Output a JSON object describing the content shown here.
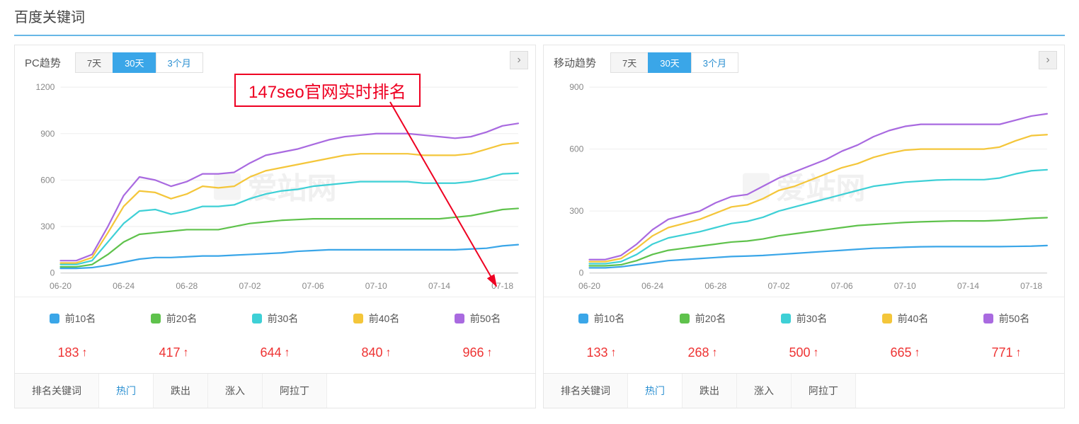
{
  "title": "百度关键词",
  "annotation": "147seo官网实时排名",
  "watermark": "爱站网",
  "range_buttons": [
    "7天",
    "30天",
    "3个月"
  ],
  "panels": [
    {
      "key": "pc",
      "title": "PC趋势",
      "active_range": "30天",
      "stats": [
        183,
        417,
        644,
        840,
        966
      ],
      "tabs": [
        "排名关键词",
        "热门",
        "跌出",
        "涨入",
        "阿拉丁"
      ],
      "active_tab": "热门"
    },
    {
      "key": "mobile",
      "title": "移动趋势",
      "active_range": "30天",
      "stats": [
        133,
        268,
        500,
        665,
        771
      ],
      "tabs": [
        "排名关键词",
        "热门",
        "跌出",
        "涨入",
        "阿拉丁"
      ],
      "active_tab": "热门"
    }
  ],
  "legend": [
    {
      "label": "前10名",
      "color": "#3aa6e8"
    },
    {
      "label": "前20名",
      "color": "#5fc24c"
    },
    {
      "label": "前30名",
      "color": "#3ed0d6"
    },
    {
      "label": "前40名",
      "color": "#f4c63a"
    },
    {
      "label": "前50名",
      "color": "#a96ae0"
    }
  ],
  "chart_data": [
    {
      "panel": "pc",
      "type": "line",
      "xlabel": "",
      "ylabel": "",
      "title": "",
      "x_ticks": [
        "06-20",
        "06-24",
        "06-28",
        "07-02",
        "07-06",
        "07-10",
        "07-14",
        "07-18"
      ],
      "y_ticks": [
        0,
        300,
        600,
        900,
        1200
      ],
      "ylim": [
        0,
        1200
      ],
      "categories": [
        "06-20",
        "06-21",
        "06-22",
        "06-23",
        "06-24",
        "06-25",
        "06-26",
        "06-27",
        "06-28",
        "06-29",
        "06-30",
        "07-01",
        "07-02",
        "07-03",
        "07-04",
        "07-05",
        "07-06",
        "07-07",
        "07-08",
        "07-09",
        "07-10",
        "07-11",
        "07-12",
        "07-13",
        "07-14",
        "07-15",
        "07-16",
        "07-17",
        "07-18",
        "07-19"
      ],
      "series": [
        {
          "name": "前10名",
          "color": "#3aa6e8",
          "values": [
            30,
            30,
            35,
            50,
            70,
            90,
            100,
            100,
            105,
            110,
            110,
            115,
            120,
            125,
            130,
            140,
            145,
            150,
            150,
            150,
            150,
            150,
            150,
            150,
            150,
            150,
            155,
            160,
            175,
            183
          ]
        },
        {
          "name": "前20名",
          "color": "#5fc24c",
          "values": [
            40,
            40,
            55,
            120,
            200,
            250,
            260,
            270,
            280,
            280,
            280,
            300,
            320,
            330,
            340,
            345,
            350,
            350,
            350,
            350,
            350,
            350,
            350,
            350,
            350,
            360,
            370,
            390,
            410,
            417
          ]
        },
        {
          "name": "前30名",
          "color": "#3ed0d6",
          "values": [
            55,
            55,
            80,
            200,
            320,
            400,
            410,
            380,
            400,
            430,
            430,
            440,
            480,
            510,
            530,
            540,
            560,
            570,
            580,
            590,
            590,
            590,
            590,
            580,
            580,
            580,
            590,
            610,
            640,
            644
          ]
        },
        {
          "name": "前40名",
          "color": "#f4c63a",
          "values": [
            65,
            65,
            100,
            260,
            430,
            530,
            520,
            480,
            510,
            560,
            550,
            560,
            620,
            660,
            680,
            700,
            720,
            740,
            760,
            770,
            770,
            770,
            770,
            760,
            760,
            760,
            770,
            800,
            830,
            840
          ]
        },
        {
          "name": "前50名",
          "color": "#a96ae0",
          "values": [
            80,
            80,
            120,
            300,
            500,
            620,
            600,
            560,
            590,
            640,
            640,
            650,
            710,
            760,
            780,
            800,
            830,
            860,
            880,
            890,
            900,
            900,
            900,
            890,
            880,
            870,
            880,
            910,
            950,
            966
          ]
        }
      ]
    },
    {
      "panel": "mobile",
      "type": "line",
      "xlabel": "",
      "ylabel": "",
      "title": "",
      "x_ticks": [
        "06-20",
        "06-24",
        "06-28",
        "07-02",
        "07-06",
        "07-10",
        "07-14",
        "07-18"
      ],
      "y_ticks": [
        0,
        300,
        600,
        900
      ],
      "ylim": [
        0,
        900
      ],
      "categories": [
        "06-20",
        "06-21",
        "06-22",
        "06-23",
        "06-24",
        "06-25",
        "06-26",
        "06-27",
        "06-28",
        "06-29",
        "06-30",
        "07-01",
        "07-02",
        "07-03",
        "07-04",
        "07-05",
        "07-06",
        "07-07",
        "07-08",
        "07-09",
        "07-10",
        "07-11",
        "07-12",
        "07-13",
        "07-14",
        "07-15",
        "07-16",
        "07-17",
        "07-18",
        "07-19"
      ],
      "series": [
        {
          "name": "前10名",
          "color": "#3aa6e8",
          "values": [
            25,
            25,
            30,
            40,
            50,
            60,
            65,
            70,
            75,
            80,
            82,
            85,
            90,
            95,
            100,
            105,
            110,
            115,
            120,
            122,
            125,
            127,
            128,
            128,
            128,
            128,
            128,
            129,
            130,
            133
          ]
        },
        {
          "name": "前20名",
          "color": "#5fc24c",
          "values": [
            35,
            35,
            40,
            60,
            90,
            110,
            120,
            130,
            140,
            150,
            155,
            165,
            180,
            190,
            200,
            210,
            220,
            230,
            235,
            240,
            245,
            248,
            250,
            252,
            252,
            252,
            255,
            260,
            265,
            268
          ]
        },
        {
          "name": "前30名",
          "color": "#3ed0d6",
          "values": [
            45,
            45,
            55,
            90,
            140,
            170,
            185,
            200,
            220,
            240,
            250,
            270,
            300,
            320,
            340,
            360,
            380,
            400,
            420,
            430,
            440,
            445,
            450,
            452,
            452,
            452,
            460,
            480,
            495,
            500
          ]
        },
        {
          "name": "前40名",
          "color": "#f4c63a",
          "values": [
            55,
            55,
            70,
            120,
            180,
            220,
            240,
            260,
            290,
            320,
            330,
            360,
            400,
            420,
            450,
            480,
            510,
            530,
            560,
            580,
            595,
            600,
            600,
            600,
            600,
            600,
            610,
            640,
            665,
            670
          ]
        },
        {
          "name": "前50名",
          "color": "#a96ae0",
          "values": [
            65,
            65,
            85,
            140,
            210,
            260,
            280,
            300,
            340,
            370,
            380,
            420,
            460,
            490,
            520,
            550,
            590,
            620,
            660,
            690,
            710,
            720,
            720,
            720,
            720,
            720,
            720,
            740,
            760,
            771
          ]
        }
      ]
    }
  ]
}
